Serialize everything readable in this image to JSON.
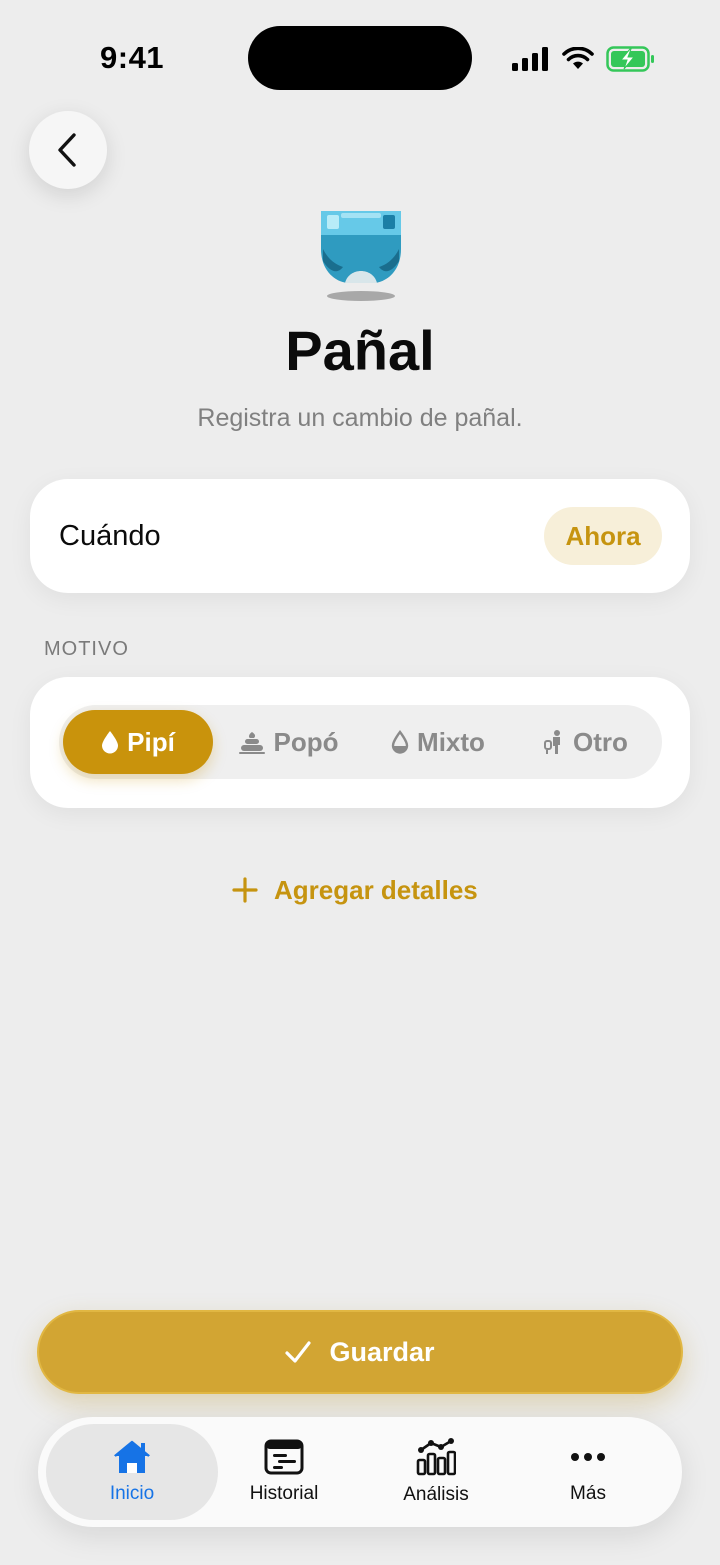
{
  "status_bar": {
    "time": "9:41",
    "battery_color": "#34c759"
  },
  "header": {
    "title": "Pañal",
    "subtitle": "Registra un cambio de pañal.",
    "illustration": "diaper-icon"
  },
  "when": {
    "label": "Cuándo",
    "value": "Ahora"
  },
  "reason": {
    "section_label": "MOTIVO",
    "selected": "Pipí",
    "options": [
      {
        "label": "Pipí",
        "icon": "droplet-icon"
      },
      {
        "label": "Popó",
        "icon": "poop-icon"
      },
      {
        "label": "Mixto",
        "icon": "droplet-outline-icon"
      },
      {
        "label": "Otro",
        "icon": "diaper-change-icon"
      }
    ]
  },
  "add_details": {
    "label": "Agregar detalles"
  },
  "save": {
    "label": "Guardar"
  },
  "tab_bar": {
    "items": [
      {
        "label": "Inicio",
        "icon": "home-icon",
        "active": true
      },
      {
        "label": "Historial",
        "icon": "history-icon"
      },
      {
        "label": "Análisis",
        "icon": "analytics-icon"
      },
      {
        "label": "Más",
        "icon": "more-icon"
      }
    ]
  },
  "colors": {
    "accent": "#c9930c",
    "save_button": "#d2a533",
    "active_tab": "#1673e6",
    "background": "#ededed"
  }
}
